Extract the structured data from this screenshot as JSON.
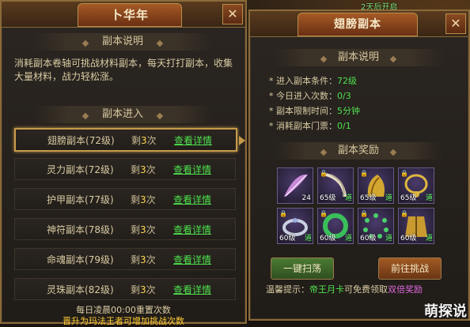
{
  "world": {
    "tag": "2天后开启"
  },
  "left_panel": {
    "title": "卜华年",
    "close": "✕",
    "desc_heading": "副本说明",
    "desc_text": "消耗副本卷轴可挑战材料副本，每天打打副本，收集大量材料，战力轻松涨。",
    "entry_heading": "副本进入",
    "rows": [
      {
        "name": "翅膀副本",
        "level": "(72级)",
        "left": "剩",
        "count": "3",
        "unit": "次",
        "detail": "查看详情"
      },
      {
        "name": "灵力副本",
        "level": "(72级)",
        "left": "剩",
        "count": "3",
        "unit": "次",
        "detail": "查看详情"
      },
      {
        "name": "护甲副本",
        "level": "(77级)",
        "left": "剩",
        "count": "3",
        "unit": "次",
        "detail": "查看详情"
      },
      {
        "name": "神符副本",
        "level": "(78级)",
        "left": "剩",
        "count": "3",
        "unit": "次",
        "detail": "查看详情"
      },
      {
        "name": "命魂副本",
        "level": "(79级)",
        "left": "剩",
        "count": "3",
        "unit": "次",
        "detail": "查看详情"
      },
      {
        "name": "灵珠副本",
        "level": "(82级)",
        "left": "剩",
        "count": "3",
        "unit": "次",
        "detail": "查看详情"
      }
    ],
    "reset_text": "每日凌晨00:00重置次数",
    "bottom_text": "晋升为玛法王者可增加挑战次数"
  },
  "right_panel": {
    "title": "翅膀副本",
    "close": "✕",
    "desc_heading": "副本说明",
    "info": [
      {
        "label": "* 进入副本条件：",
        "value": "72级",
        "color": "green"
      },
      {
        "label": "* 今日进入次数：",
        "value": "0/3",
        "color": "green"
      },
      {
        "label": "* 副本限制时间：",
        "value": "5分钟",
        "color": "green"
      },
      {
        "label": "* 消耗副本门票：",
        "value": "0/1",
        "color": "green"
      }
    ],
    "reward_heading": "副本奖励",
    "rewards": [
      {
        "icon": "feather-icon",
        "level": "",
        "count": "24",
        "tag": ""
      },
      {
        "icon": "claw-blade-icon",
        "level": "65级",
        "count": "",
        "tag": "道"
      },
      {
        "icon": "golden-wing-icon",
        "level": "65级",
        "count": "",
        "tag": "道"
      },
      {
        "icon": "gold-necklace-icon",
        "level": "65级",
        "count": "",
        "tag": "道"
      },
      {
        "icon": "silver-ring-icon",
        "level": "60级",
        "count": "",
        "tag": "道"
      },
      {
        "icon": "jade-bracelet-icon",
        "level": "60级",
        "count": "",
        "tag": "道"
      },
      {
        "icon": "green-bead-bracelet-icon",
        "level": "60级",
        "count": "",
        "tag": "道"
      },
      {
        "icon": "gold-armor-icon",
        "level": "60级",
        "count": "",
        "tag": "道"
      }
    ],
    "sweep_button": "一键扫荡",
    "challenge_button": "前往挑战",
    "tip_label": "温馨提示：",
    "tip_card": "帝王月卡",
    "tip_mid": "可免费领取",
    "tip_reward": "双倍奖励"
  },
  "watermark": "萌探说",
  "colors": {
    "accent_gold": "#c79a4a",
    "green": "#4ee04e",
    "count_yellow": "#ffd850",
    "purple": "#e06ae0"
  }
}
